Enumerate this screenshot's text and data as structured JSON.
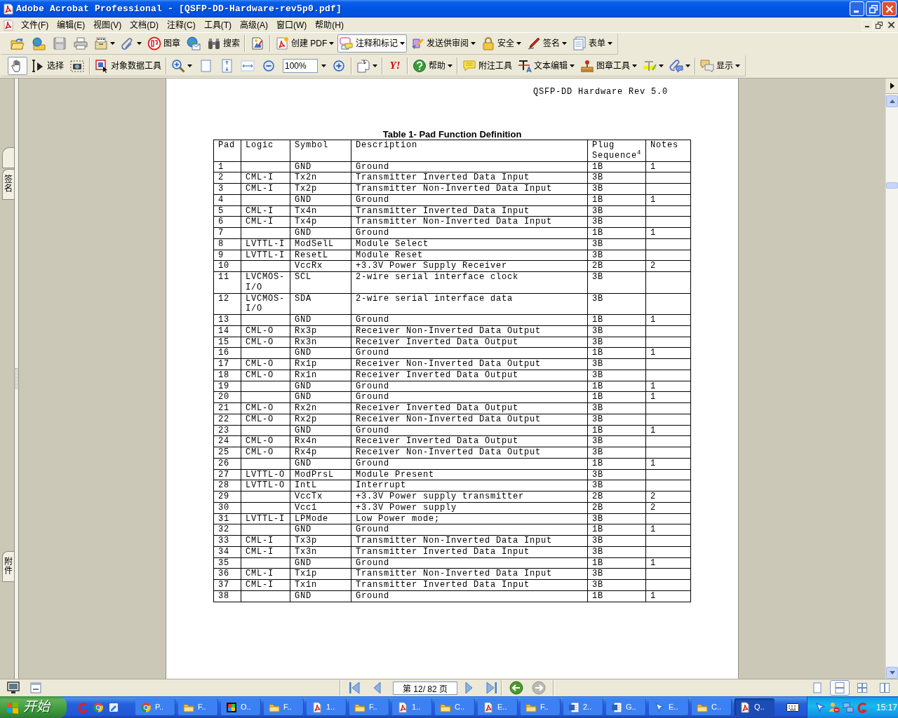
{
  "window": {
    "title": "Adobe Acrobat Professional - [QSFP-DD-Hardware-rev5p0.pdf]"
  },
  "menu_bar": {
    "items": [
      "文件(F)",
      "编辑(E)",
      "视图(V)",
      "文档(D)",
      "注释(C)",
      "工具(T)",
      "高级(A)",
      "窗口(W)",
      "帮助(H)"
    ]
  },
  "toolbars": [
    {
      "items": [
        {
          "kind": "open",
          "pressed": false
        },
        {
          "kind": "web",
          "pressed": false
        },
        {
          "kind": "save",
          "pressed": false
        },
        {
          "kind": "print",
          "pressed": false
        },
        {
          "kind": "organizer",
          "pressed": false,
          "dropdown": true
        },
        {
          "kind": "attach",
          "pressed": false,
          "dropdown": true
        },
        {
          "kind": "stamp",
          "label": "图章",
          "pressed": false
        },
        {
          "kind": "email",
          "pressed": false
        },
        {
          "kind": "search",
          "label": "搜索",
          "pressed": false
        },
        {
          "kind": "separator"
        },
        {
          "kind": "properties",
          "pressed": false
        },
        {
          "kind": "separator"
        },
        {
          "kind": "create",
          "label": "创建 PDF",
          "pressed": false,
          "dropdown": true
        },
        {
          "kind": "comment",
          "label": "注释和标记",
          "pressed": true,
          "dropdown": true
        },
        {
          "kind": "review",
          "label": "发送供审阅",
          "pressed": false,
          "dropdown": true
        },
        {
          "kind": "security",
          "label": "安全",
          "pressed": false,
          "dropdown": true
        },
        {
          "kind": "sign",
          "label": "签名",
          "pressed": false,
          "dropdown": true
        },
        {
          "kind": "forms",
          "label": "表单",
          "pressed": false,
          "dropdown": true
        }
      ]
    },
    {
      "items": [
        {
          "kind": "hand",
          "pressed": true
        },
        {
          "kind": "select",
          "label": "选择",
          "pressed": false
        },
        {
          "kind": "snapshot",
          "pressed": false
        },
        {
          "kind": "separator"
        },
        {
          "kind": "objectdata",
          "label": "对象数据工具",
          "pressed": false
        },
        {
          "kind": "separator"
        },
        {
          "kind": "zoomtool",
          "pressed": false,
          "dropdown": true
        },
        {
          "kind": "actual",
          "pressed": false
        },
        {
          "kind": "fitpage",
          "pressed": false
        },
        {
          "kind": "fitwidth",
          "pressed": false
        },
        {
          "kind": "zoomout",
          "pressed": false
        },
        {
          "kind": "zoom_field",
          "value": "100%"
        },
        {
          "kind": "zoomin",
          "pressed": false
        },
        {
          "kind": "separator"
        },
        {
          "kind": "rotate",
          "pressed": false,
          "dropdown": true
        },
        {
          "kind": "separator"
        },
        {
          "kind": "logo",
          "label": "Y!",
          "pressed": false
        },
        {
          "kind": "separator"
        },
        {
          "kind": "help",
          "label": "帮助",
          "pressed": false,
          "dropdown": true
        },
        {
          "kind": "separator"
        },
        {
          "kind": "note",
          "label": "附注工具",
          "pressed": false
        },
        {
          "kind": "textedit",
          "label": "文本编辑",
          "pressed": false,
          "dropdown": true
        },
        {
          "kind": "stamptool",
          "label": "图章工具",
          "pressed": false,
          "dropdown": true
        },
        {
          "kind": "highlight",
          "pressed": false,
          "dropdown": true
        },
        {
          "kind": "attachcomment",
          "pressed": false,
          "dropdown": true
        },
        {
          "kind": "separator"
        },
        {
          "kind": "show",
          "label": "显示",
          "pressed": false,
          "dropdown": true
        }
      ]
    }
  ],
  "side_panel": {
    "tabs": [
      {
        "label": "签名",
        "selected": false
      },
      {
        "label": "附件",
        "selected": false
      }
    ]
  },
  "document": {
    "running_header": "QSFP-DD Hardware Rev 5.0",
    "table": {
      "caption": "Table 1- Pad Function Definition",
      "columns": [
        "Pad",
        "Logic",
        "Symbol",
        "Description",
        "Plug Sequence$^{4}$",
        "Notes"
      ],
      "rows": [
        {
          "pad": "1",
          "symbol": "GND",
          "description": "Ground",
          "sequence": "1B",
          "notes": "1"
        },
        {
          "pad": "2",
          "logic": "CML-I",
          "symbol": "Tx2n",
          "description": "Transmitter Inverted Data Input",
          "sequence": "3B"
        },
        {
          "pad": "3",
          "logic": "CML-I",
          "symbol": "Tx2p",
          "description": "Transmitter Non-Inverted Data Input",
          "sequence": "3B"
        },
        {
          "pad": "4",
          "symbol": "GND",
          "description": "Ground",
          "sequence": "1B",
          "notes": "1"
        },
        {
          "pad": "5",
          "logic": "CML-I",
          "symbol": "Tx4n",
          "description": "Transmitter Inverted Data Input",
          "sequence": "3B"
        },
        {
          "pad": "6",
          "logic": "CML-I",
          "symbol": "Tx4p",
          "description": "Transmitter Non-Inverted Data Input",
          "sequence": "3B"
        },
        {
          "pad": "7",
          "symbol": "GND",
          "description": "Ground",
          "sequence": "1B",
          "notes": "1"
        },
        {
          "pad": "8",
          "logic": "LVTTL-I",
          "symbol": "ModSelL",
          "description": "Module Select",
          "sequence": "3B"
        },
        {
          "pad": "9",
          "logic": "LVTTL-I",
          "symbol": "ResetL",
          "description": "Module Reset",
          "sequence": "3B"
        },
        {
          "pad": "10",
          "symbol": "VccRx",
          "description": "+3.3V Power Supply Receiver",
          "sequence": "2B",
          "notes": "2"
        },
        {
          "pad": "11",
          "logic": "LVCMOS-I/O",
          "symbol": "SCL",
          "description": "2-wire serial interface clock",
          "sequence": "3B"
        },
        {
          "pad": "12",
          "logic": "LVCMOS-I/O",
          "symbol": "SDA",
          "description": "2-wire serial interface data",
          "sequence": "3B"
        },
        {
          "pad": "13",
          "symbol": "GND",
          "description": "Ground",
          "sequence": "1B",
          "notes": "1"
        },
        {
          "pad": "14",
          "logic": "CML-O",
          "symbol": "Rx3p",
          "description": "Receiver Non-Inverted Data Output",
          "sequence": "3B"
        },
        {
          "pad": "15",
          "logic": "CML-O",
          "symbol": "Rx3n",
          "description": "Receiver Inverted Data Output",
          "sequence": "3B"
        },
        {
          "pad": "16",
          "symbol": "GND",
          "description": "Ground",
          "sequence": "1B",
          "notes": "1"
        },
        {
          "pad": "17",
          "logic": "CML-O",
          "symbol": "Rx1p",
          "description": "Receiver Non-Inverted Data Output",
          "sequence": "3B"
        },
        {
          "pad": "18",
          "logic": "CML-O",
          "symbol": "Rx1n",
          "description": "Receiver Inverted Data Output",
          "sequence": "3B"
        },
        {
          "pad": "19",
          "symbol": "GND",
          "description": "Ground",
          "sequence": "1B",
          "notes": "1"
        },
        {
          "pad": "20",
          "symbol": "GND",
          "description": "Ground",
          "sequence": "1B",
          "notes": "1"
        },
        {
          "pad": "21",
          "logic": "CML-O",
          "symbol": "Rx2n",
          "description": "Receiver Inverted Data Output",
          "sequence": "3B"
        },
        {
          "pad": "22",
          "logic": "CML-O",
          "symbol": "Rx2p",
          "description": "Receiver Non-Inverted Data Output",
          "sequence": "3B"
        },
        {
          "pad": "23",
          "symbol": "GND",
          "description": "Ground",
          "sequence": "1B",
          "notes": "1"
        },
        {
          "pad": "24",
          "logic": "CML-O",
          "symbol": "Rx4n",
          "description": "Receiver Inverted Data Output",
          "sequence": "3B"
        },
        {
          "pad": "25",
          "logic": "CML-O",
          "symbol": "Rx4p",
          "description": "Receiver Non-Inverted Data Output",
          "sequence": "3B"
        },
        {
          "pad": "26",
          "symbol": "GND",
          "description": "Ground",
          "sequence": "1B",
          "notes": "1"
        },
        {
          "pad": "27",
          "logic": "LVTTL-O",
          "symbol": "ModPrsL",
          "description": "Module Present",
          "sequence": "3B"
        },
        {
          "pad": "28",
          "logic": "LVTTL-O",
          "symbol": "IntL",
          "description": "Interrupt",
          "sequence": "3B"
        },
        {
          "pad": "29",
          "symbol": "VccTx",
          "description": "+3.3V Power supply transmitter",
          "sequence": "2B",
          "notes": "2"
        },
        {
          "pad": "30",
          "symbol": "Vcc1",
          "description": "+3.3V Power supply",
          "sequence": "2B",
          "notes": "2"
        },
        {
          "pad": "31",
          "logic": "LVTTL-I",
          "symbol": "LPMode",
          "description": "Low Power mode;",
          "sequence": "3B"
        },
        {
          "pad": "32",
          "symbol": "GND",
          "description": "Ground",
          "sequence": "1B",
          "notes": "1"
        },
        {
          "pad": "33",
          "logic": "CML-I",
          "symbol": "Tx3p",
          "description": "Transmitter Non-Inverted Data Input",
          "sequence": "3B"
        },
        {
          "pad": "34",
          "logic": "CML-I",
          "symbol": "Tx3n",
          "description": "Transmitter Inverted Data Input",
          "sequence": "3B"
        },
        {
          "pad": "35",
          "symbol": "GND",
          "description": "Ground",
          "sequence": "1B",
          "notes": "1"
        },
        {
          "pad": "36",
          "logic": "CML-I",
          "symbol": "Tx1p",
          "description": "Transmitter Non-Inverted Data Input",
          "sequence": "3B"
        },
        {
          "pad": "37",
          "logic": "CML-I",
          "symbol": "Tx1n",
          "description": "Transmitter Inverted Data Input",
          "sequence": "3B"
        },
        {
          "pad": "38",
          "symbol": "GND",
          "description": "Ground",
          "sequence": "1B",
          "notes": "1"
        }
      ]
    }
  },
  "status_bar": {
    "navigation": [
      {
        "kind": "first"
      },
      {
        "kind": "previous"
      },
      {
        "kind": "page_field",
        "value": "第 12/ 82 页"
      },
      {
        "kind": "next"
      },
      {
        "kind": "last"
      }
    ],
    "history": [
      {
        "kind": "back",
        "disabled": false
      },
      {
        "kind": "forward",
        "disabled": true
      }
    ],
    "layouts": [
      {
        "kind": "single",
        "selected": false
      },
      {
        "kind": "continuous",
        "selected": true
      },
      {
        "kind": "facing",
        "selected": false
      },
      {
        "kind": "continuous_facing",
        "selected": false
      }
    ]
  },
  "taskbar": {
    "start": "开始",
    "quick_launch": [
      {
        "kind": "swirl"
      },
      {
        "kind": "browser"
      },
      {
        "kind": "notepad"
      }
    ],
    "tasks": [
      {
        "kind": "browser",
        "label": "P..",
        "selected": false
      },
      {
        "kind": "folder",
        "label": "F..",
        "selected": false
      },
      {
        "kind": "mosaic",
        "label": "O..",
        "selected": false
      },
      {
        "kind": "folder",
        "label": "F..",
        "selected": false
      },
      {
        "kind": "pdf",
        "label": "1..",
        "selected": false
      },
      {
        "kind": "folder",
        "label": "F..",
        "selected": false
      },
      {
        "kind": "pdf",
        "label": "1..",
        "selected": false
      },
      {
        "kind": "folder",
        "label": "C..",
        "selected": false
      },
      {
        "kind": "pdf",
        "label": "E..",
        "selected": false
      },
      {
        "kind": "folder",
        "label": "F..",
        "selected": false
      },
      {
        "kind": "word",
        "label": "2..",
        "selected": false
      },
      {
        "kind": "word",
        "label": "G..",
        "selected": false
      },
      {
        "kind": "cursor",
        "label": "E..",
        "selected": false
      },
      {
        "kind": "folder",
        "label": "C..",
        "selected": false
      },
      {
        "kind": "pdf",
        "label": "Q..",
        "selected": true
      }
    ],
    "tray": {
      "icons": [
        {
          "kind": "cursor"
        },
        {
          "kind": "user_alert"
        },
        {
          "kind": "network"
        },
        {
          "kind": "swirl"
        }
      ],
      "clock": "15:17"
    }
  }
}
